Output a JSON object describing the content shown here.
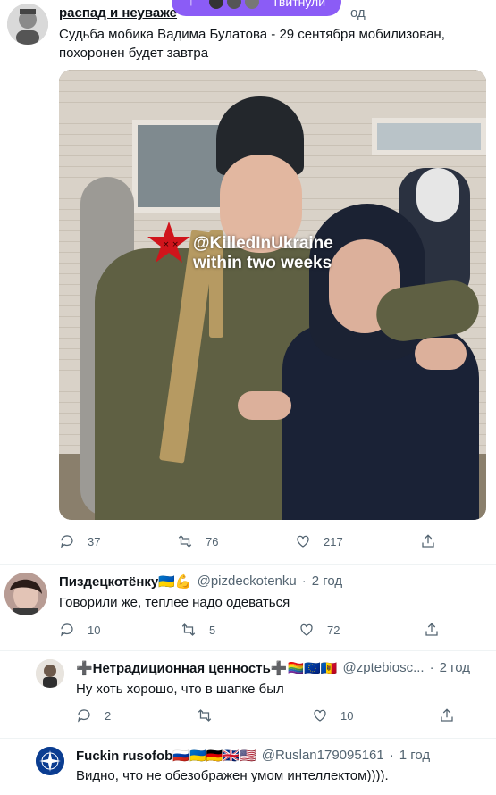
{
  "top_pill": {
    "label": "Твитнули"
  },
  "tweet1": {
    "author": "распад и неуваже",
    "time": "од",
    "text_line1": "Судьба мобика Вадима Булатова - 29 сентября мобилизован,",
    "text_line2": "похоронен будет завтра",
    "watermark_line1": "@KilledInUkraine",
    "watermark_line2": "within two weeks",
    "replies": "37",
    "retweets": "76",
    "likes": "217"
  },
  "reply1": {
    "name": "Пиздецкотёнку🇺🇦💪",
    "handle": "@pizdeckotenku",
    "time": "2 год",
    "text": "Говорили же, теплее надо одеваться",
    "replies": "10",
    "retweets": "5",
    "likes": "72"
  },
  "reply2": {
    "name": "➕Нетрадиционная ценность➕🏳️‍🌈🇪🇺🇲🇩",
    "handle": "@zptebiosc...",
    "time": "2 год",
    "text": "Ну хоть хорошо, что в шапке был",
    "replies": "2",
    "retweets": "",
    "likes": "10"
  },
  "reply3": {
    "name": "Fuckin rusofob🇷🇺🇺🇦🇩🇪🇬🇧🇺🇸",
    "handle": "@Ruslan179095161",
    "time": "1 год",
    "text": "Видно, что не обезображен умом интеллектом)))).",
    "avatar_label": "NATO"
  },
  "colors": {
    "accent_pill": "#8b5cf6",
    "meta": "#536471",
    "star": "#d0141b"
  }
}
